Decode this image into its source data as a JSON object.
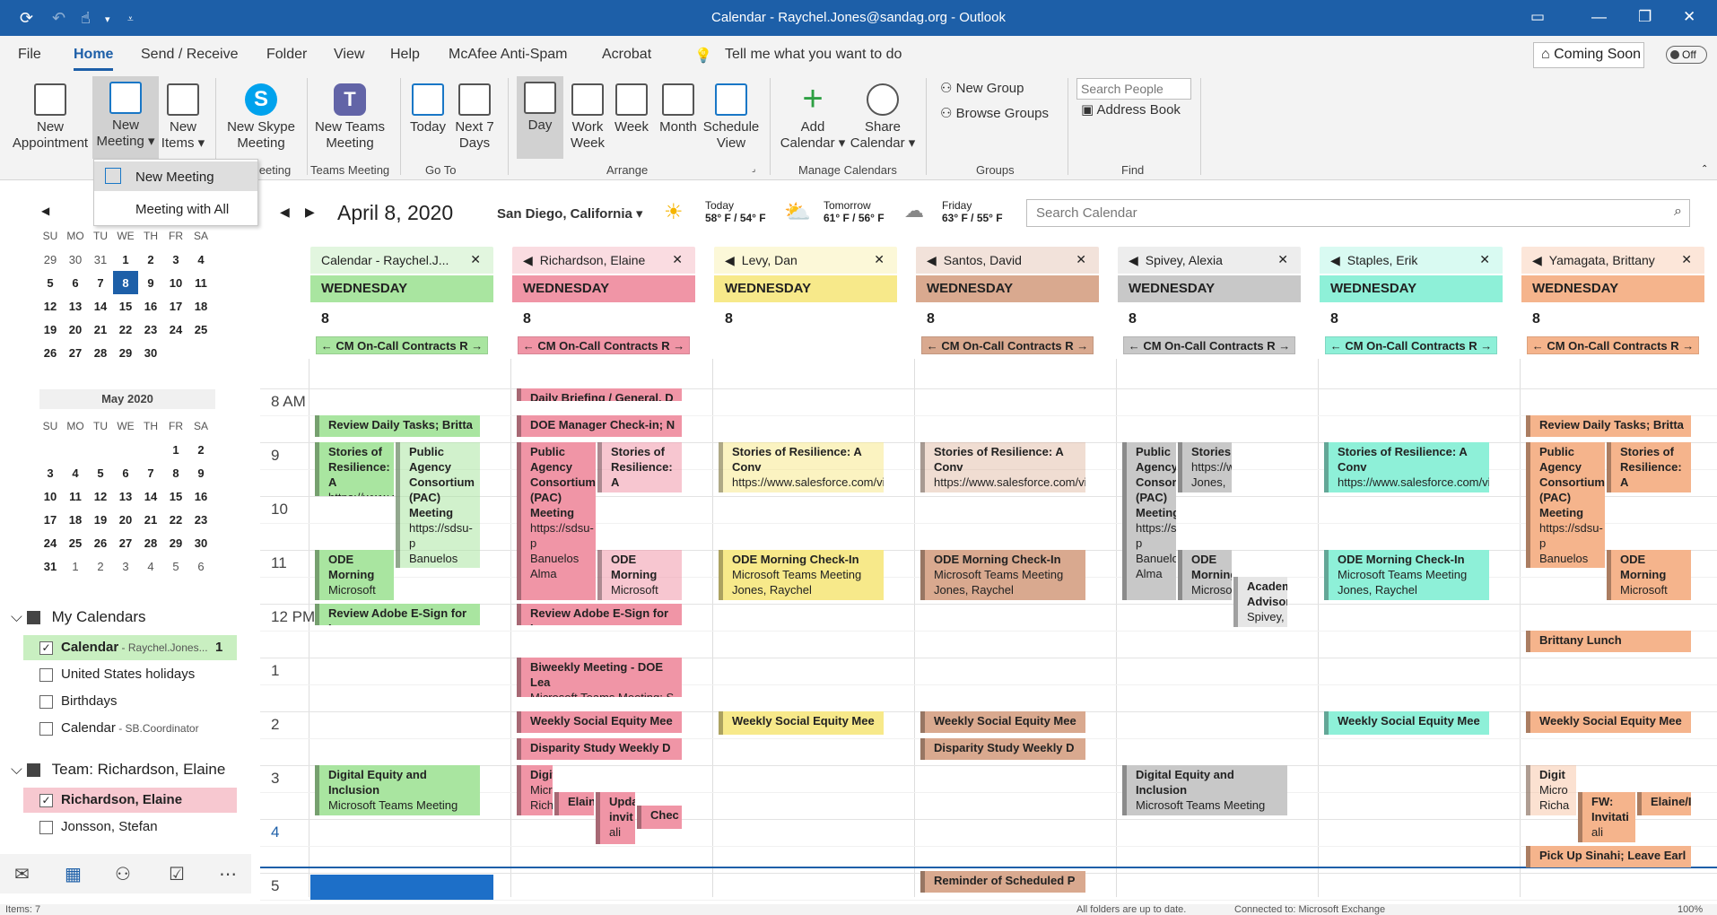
{
  "window": {
    "title": "Calendar - Raychel.Jones@sandag.org  -  Outlook"
  },
  "menu": {
    "file": "File",
    "home": "Home",
    "send_receive": "Send / Receive",
    "folder": "Folder",
    "view": "View",
    "help": "Help",
    "mcafee": "McAfee Anti-Spam",
    "acrobat": "Acrobat",
    "tell_me": "Tell me what you want to do",
    "coming_soon": "Coming Soon",
    "toggle": "Off"
  },
  "ribbon": {
    "new_appointment": "New Appointment",
    "new_meeting": "New Meeting",
    "new_items": "New Items",
    "new_skype": "New Skype Meeting",
    "new_teams": "New Teams Meeting",
    "today": "Today",
    "next7": "Next 7 Days",
    "day": "Day",
    "work_week": "Work Week",
    "week": "Week",
    "month": "Month",
    "schedule_view": "Schedule View",
    "add_calendar": "Add Calendar",
    "share_calendar": "Share Calendar",
    "new_group": "New Group",
    "browse_groups": "Browse Groups",
    "search_people": "Search People",
    "address_book": "Address Book",
    "grp_meeting": "Meeting",
    "grp_teams": "Teams Meeting",
    "grp_goto": "Go To",
    "grp_arrange": "Arrange",
    "grp_manage": "Manage Calendars",
    "grp_groups": "Groups",
    "grp_find": "Find"
  },
  "dropdown": {
    "items": [
      "New Meeting",
      "Meeting with All"
    ]
  },
  "minical": {
    "dow": [
      "SU",
      "MO",
      "TU",
      "WE",
      "TH",
      "FR",
      "SA"
    ],
    "april": [
      [
        "29",
        "30",
        "31",
        "1",
        "2",
        "3",
        "4"
      ],
      [
        "5",
        "6",
        "7",
        "8",
        "9",
        "10",
        "11"
      ],
      [
        "12",
        "13",
        "14",
        "15",
        "16",
        "17",
        "18"
      ],
      [
        "19",
        "20",
        "21",
        "22",
        "23",
        "24",
        "25"
      ],
      [
        "26",
        "27",
        "28",
        "29",
        "30",
        "",
        ""
      ]
    ],
    "may_title": "May 2020",
    "may": [
      [
        "",
        "",
        "",
        "",
        "",
        "1",
        "2"
      ],
      [
        "3",
        "4",
        "5",
        "6",
        "7",
        "8",
        "9"
      ],
      [
        "10",
        "11",
        "12",
        "13",
        "14",
        "15",
        "16"
      ],
      [
        "17",
        "18",
        "19",
        "20",
        "21",
        "22",
        "23"
      ],
      [
        "24",
        "25",
        "26",
        "27",
        "28",
        "29",
        "30"
      ],
      [
        "31",
        "1",
        "2",
        "3",
        "4",
        "5",
        "6"
      ]
    ]
  },
  "folders": {
    "my_calendars": "My Calendars",
    "items": [
      {
        "label": "Calendar",
        "sub": " - Raychel.Jones...",
        "count": "1",
        "checked": true
      },
      {
        "label": "United States holidays",
        "sub": "",
        "checked": false
      },
      {
        "label": "Birthdays",
        "sub": "",
        "checked": false
      },
      {
        "label": "Calendar",
        "sub": " - SB.Coordinator",
        "checked": false
      }
    ],
    "team": "Team: Richardson, Elaine",
    "team_items": [
      {
        "label": "Richardson, Elaine",
        "checked": true
      },
      {
        "label": "Jonsson, Stefan",
        "checked": false
      }
    ]
  },
  "status": {
    "items": "Items: 7",
    "sync": "All folders are up to date.",
    "connected": "Connected to: Microsoft Exchange",
    "zoom": "100%"
  },
  "calhead": {
    "date": "April 8, 2020",
    "location": "San Diego, California",
    "today_label": "Today",
    "today_temp": "58° F / 54° F",
    "tomorrow_label": "Tomorrow",
    "tomorrow_temp": "61° F / 56° F",
    "friday_label": "Friday",
    "friday_temp": "63° F / 55° F",
    "search": "Search Calendar"
  },
  "times": [
    "8 AM",
    "9",
    "10",
    "11",
    "12 PM",
    "1",
    "2",
    "3",
    "4",
    "5"
  ],
  "colors": {
    "green": "#a9e5a0",
    "pink": "#f095a6",
    "yellow": "#f7e98a",
    "tan": "#d9a98f",
    "gray": "#c8c8c8",
    "teal": "#8ef0d8",
    "orange": "#f5b48c"
  },
  "columns": [
    {
      "name": "Calendar - Raychel.J...",
      "day": "WEDNESDAY",
      "num": "8",
      "banner": "← CM On-Call Contracts R →"
    },
    {
      "name": "Richardson, Elaine",
      "day": "WEDNESDAY",
      "num": "8",
      "banner": "← CM On-Call Contracts R →"
    },
    {
      "name": "Levy, Dan",
      "day": "WEDNESDAY",
      "num": "8",
      "banner": ""
    },
    {
      "name": "Santos, David",
      "day": "WEDNESDAY",
      "num": "8",
      "banner": "← CM On-Call Contracts R →"
    },
    {
      "name": "Spivey, Alexia",
      "day": "WEDNESDAY",
      "num": "8",
      "banner": "← CM On-Call Contracts R →"
    },
    {
      "name": "Staples, Erik",
      "day": "WEDNESDAY",
      "num": "8",
      "banner": "← CM On-Call Contracts R →"
    },
    {
      "name": "Yamagata, Brittany",
      "day": "WEDNESDAY",
      "num": "8",
      "banner": "← CM On-Call Contracts R →"
    }
  ],
  "events": {
    "review_daily": "Review Daily Tasks; Britta",
    "stories": "Stories of Resilience: A",
    "stories_url": "https://www.s",
    "pac": "Public Agency Consortium (PAC) Meeting",
    "pac_url": "https://sdsu-p",
    "banuelos": "Banuelos",
    "alma": "Alma",
    "ode": "ODE Morning",
    "ms": "Microsoft Teams Meeting",
    "jones": "Jones, Raychel",
    "adobe": "Review Adobe E-Sign for Inv",
    "digital": "Digital Equity and Inclusion",
    "richardson": "Richardson, Elaine",
    "daily_briefing": "Daily Briefing / General, D",
    "doe": "DOE Manager Check-in; N",
    "biweekly": "Biweekly Meeting - DOE Lea",
    "biweekly_ms": "Microsoft Teams Meeting; S",
    "social": "Weekly Social Equity Mee",
    "disparity": "Disparity Study Weekly D",
    "stories_full": "Stories of Resilience: A Conv",
    "stories_full_url": "https://www.salesforce.com/vi",
    "ode_full": "ODE Morning Check-In",
    "reminder": "Reminder of Scheduled P",
    "academ": "Academ Advisor",
    "spivey": "Spivey, A",
    "brittany_lunch": "Brittany Lunch",
    "pickup": "Pick Up Sinahi; Leave Earl",
    "fw": "FW: Invitati",
    "elaine": "Elaine/I",
    "elain": "Elain",
    "upda": "Upda invit",
    "chec": "Chec",
    "digi": "Digit",
    "micro": "Micro",
    "richa": "Richa",
    "stories_short": "Stories",
    "alma_short": "ali"
  }
}
